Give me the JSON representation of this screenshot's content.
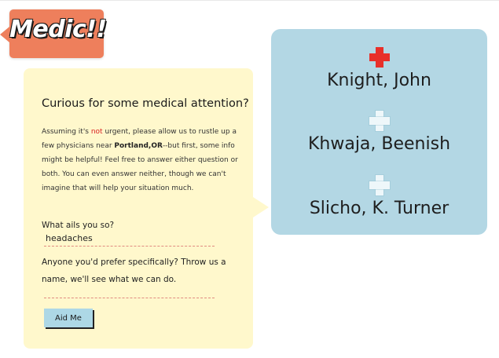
{
  "logo": {
    "text": "Medic!!",
    "color": "#ee7f5c"
  },
  "form": {
    "heading": "Curious for some medical attention?",
    "intro_part1": "Assuming it's ",
    "intro_not": "not",
    "intro_part2": " urgent, please allow us to rustle up a few physicians near ",
    "intro_location": "Portland,OR",
    "intro_part3": "--but first, some info might be helpful! Feel free to answer either question or both. You can even answer neither, though we can't imagine that will help your situation much.",
    "ailment_label": "What ails you so?",
    "ailment_value": "headaches",
    "doctor_label": "Anyone you'd prefer specifically? Throw us a name, we'll see what we can do.",
    "doctor_value": "",
    "submit_label": "Aid Me",
    "panel_color": "#fff8cc",
    "button_color": "#add8e6"
  },
  "results": {
    "panel_color": "#b3d7e4",
    "doctors": [
      {
        "name": "Knight, John",
        "icon": "red-cross-icon",
        "icon_color": "#e8302a"
      },
      {
        "name": "Khwaja, Beenish",
        "icon": "white-cross-icon",
        "icon_color": "#eef7fa"
      },
      {
        "name": "Slicho, K. Turner",
        "icon": "white-cross-icon",
        "icon_color": "#eef7fa"
      }
    ]
  }
}
